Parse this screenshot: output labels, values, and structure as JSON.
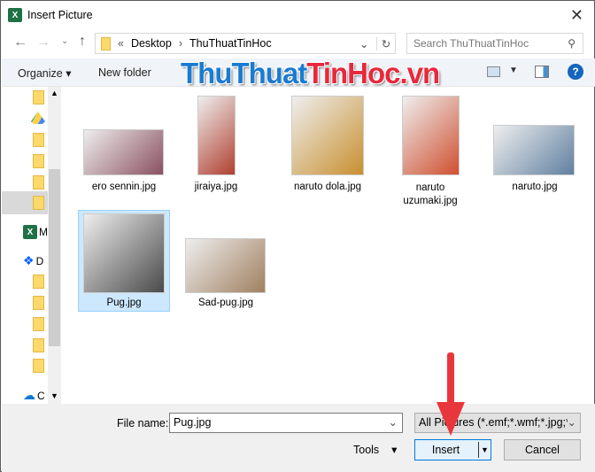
{
  "window": {
    "title": "Insert Picture",
    "close_icon": "close-icon"
  },
  "address": {
    "prefix": "«",
    "crumbs": [
      "Desktop",
      "ThuThuatTinHoc"
    ],
    "search_placeholder": "Search ThuThuatTinHoc"
  },
  "toolbar": {
    "organize": "Organize",
    "new_folder": "New folder"
  },
  "watermark": {
    "part1": "ThuThuat",
    "part2": "TinHoc.vn"
  },
  "sidebar": {
    "items": [
      "M",
      "D",
      "C"
    ]
  },
  "files": [
    {
      "name": "ero sennin.jpg",
      "color": "#8a5060"
    },
    {
      "name": "jiraiya.jpg",
      "color": "#b04030"
    },
    {
      "name": "naruto dola.jpg",
      "color": "#c89030"
    },
    {
      "name": "naruto uzumaki.jpg",
      "color": "#d05030"
    },
    {
      "name": "naruto.jpg",
      "color": "#6080a0"
    },
    {
      "name": "Pug.jpg",
      "color": "#4a4a4a",
      "selected": true
    },
    {
      "name": "Sad-pug.jpg",
      "color": "#a08060"
    }
  ],
  "footer": {
    "file_name_label": "File name:",
    "file_name_value": "Pug.jpg",
    "filter": "All Pictures (*.emf;*.wmf;*.jpg;*",
    "tools": "Tools",
    "insert": "Insert",
    "cancel": "Cancel"
  },
  "colors": {
    "accent": "#0078d7",
    "arrow": "#e8373c",
    "selection": "#cce8ff"
  }
}
